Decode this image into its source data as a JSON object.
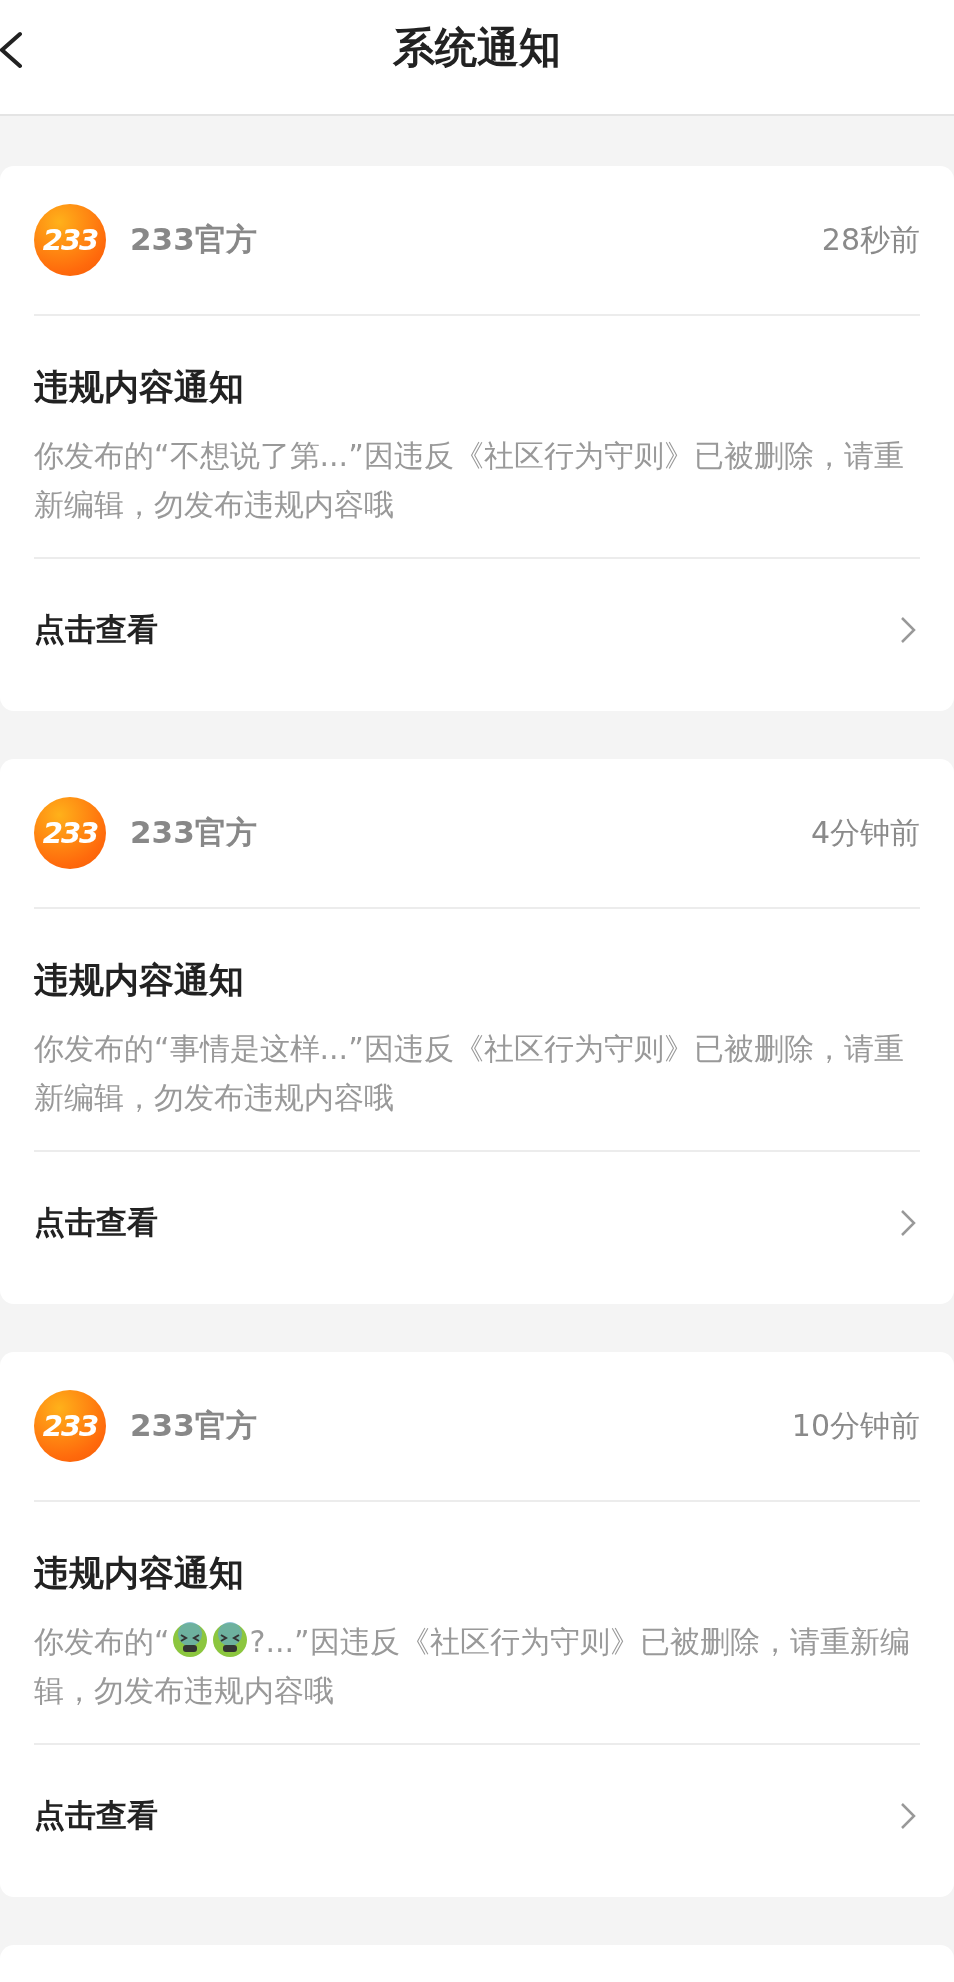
{
  "header": {
    "title": "系统通知"
  },
  "notifications": [
    {
      "logo": "233",
      "sender": "233官方",
      "time": "28秒前",
      "title": "违规内容通知",
      "message": [
        {
          "kind": "text",
          "text": "你发布的“不想说了第...”因违反《社区行为守则》已被删除，请重新编辑，勿发布违规内容哦"
        }
      ],
      "action": "点击查看"
    },
    {
      "logo": "233",
      "sender": "233官方",
      "time": "4分钟前",
      "title": "违规内容通知",
      "message": [
        {
          "kind": "text",
          "text": "你发布的“事情是这样...”因违反《社区行为守则》已被删除，请重新编辑，勿发布违规内容哦"
        }
      ],
      "action": "点击查看"
    },
    {
      "logo": "233",
      "sender": "233官方",
      "time": "10分钟前",
      "title": "违规内容通知",
      "message": [
        {
          "kind": "text",
          "text": "你发布的“"
        },
        {
          "kind": "emoji"
        },
        {
          "kind": "emoji"
        },
        {
          "kind": "text",
          "text": "?...”因违反《社区行为守则》已被删除，请重新编辑，勿发布违规内容哦"
        }
      ],
      "action": "点击查看"
    }
  ]
}
